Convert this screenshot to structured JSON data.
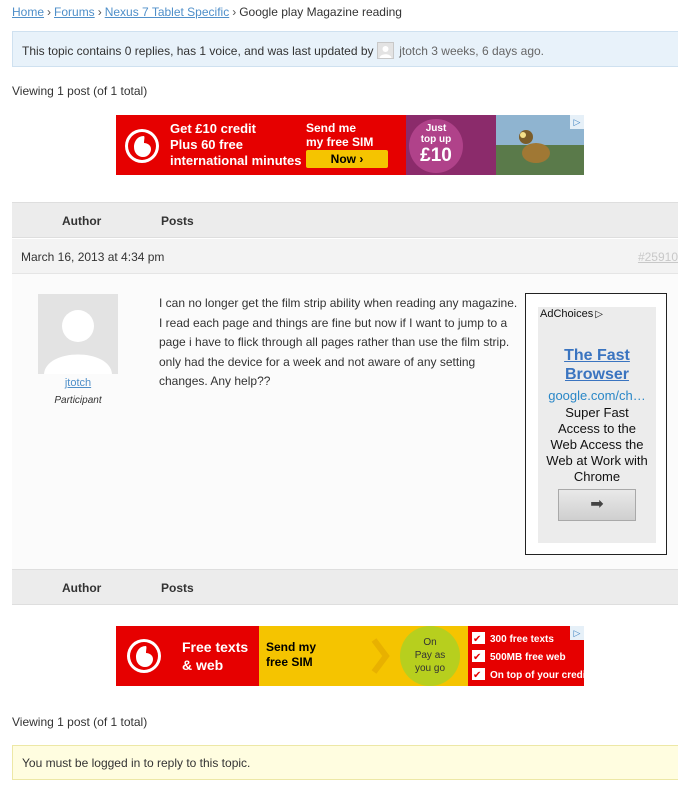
{
  "breadcrumb": {
    "home": "Home",
    "forums": "Forums",
    "forum": "Nexus 7 Tablet Specific",
    "separator": "›",
    "current": "Google play Magazine reading"
  },
  "topic_info": {
    "text_before": "This topic contains 0 replies, has 1 voice, and was last updated by",
    "user": "jtotch",
    "time": "3 weeks, 6 days ago."
  },
  "viewing": {
    "top": "Viewing 1 post (of 1 total)",
    "bottom": "Viewing 1 post (of 1 total)"
  },
  "ad_top": {
    "offer": [
      "Get £10 credit",
      "Plus 60 free",
      "international minutes"
    ],
    "cta": [
      "Send me",
      "my free SIM"
    ],
    "button": "Now ›",
    "bubble": [
      "Just",
      "top up",
      "£10"
    ],
    "choice_icon": "▷",
    "colors": {
      "red": "#e60000",
      "yellow": "#f5c400"
    }
  },
  "table": {
    "col_author": "Author",
    "col_posts": "Posts"
  },
  "post": {
    "date": "March 16, 2013 at 4:34 pm",
    "id": "#25910",
    "author": "jtotch",
    "role": "Participant",
    "content": "I can no longer get the film strip ability when reading any magazine. I read each page and things are fine but now if I want to jump to a page i have to flick through all pages rather than use the film strip. only had the device for a week and not aware of any setting changes. Any help??"
  },
  "side_ad": {
    "adchoices": "AdChoices",
    "adchoices_icon": "▷",
    "title_line1": "The Fast",
    "title_line2": "Browser",
    "url": "google.com/ch…",
    "text_lines": [
      "Super Fast",
      "Access to the",
      "Web Access the",
      "Web at Work with",
      "Chrome"
    ],
    "button_icon": "➡"
  },
  "ad_bottom": {
    "headline": [
      "Free texts",
      "& web"
    ],
    "cta": [
      "Send my",
      "free SIM"
    ],
    "bubble": [
      "On",
      "Pay as",
      "you go"
    ],
    "features": [
      "300 free texts",
      "500MB free web",
      "On top of your credit"
    ],
    "check": "✔",
    "choice_icon": "▷"
  },
  "login_message": "You must be logged in to reply to this topic."
}
